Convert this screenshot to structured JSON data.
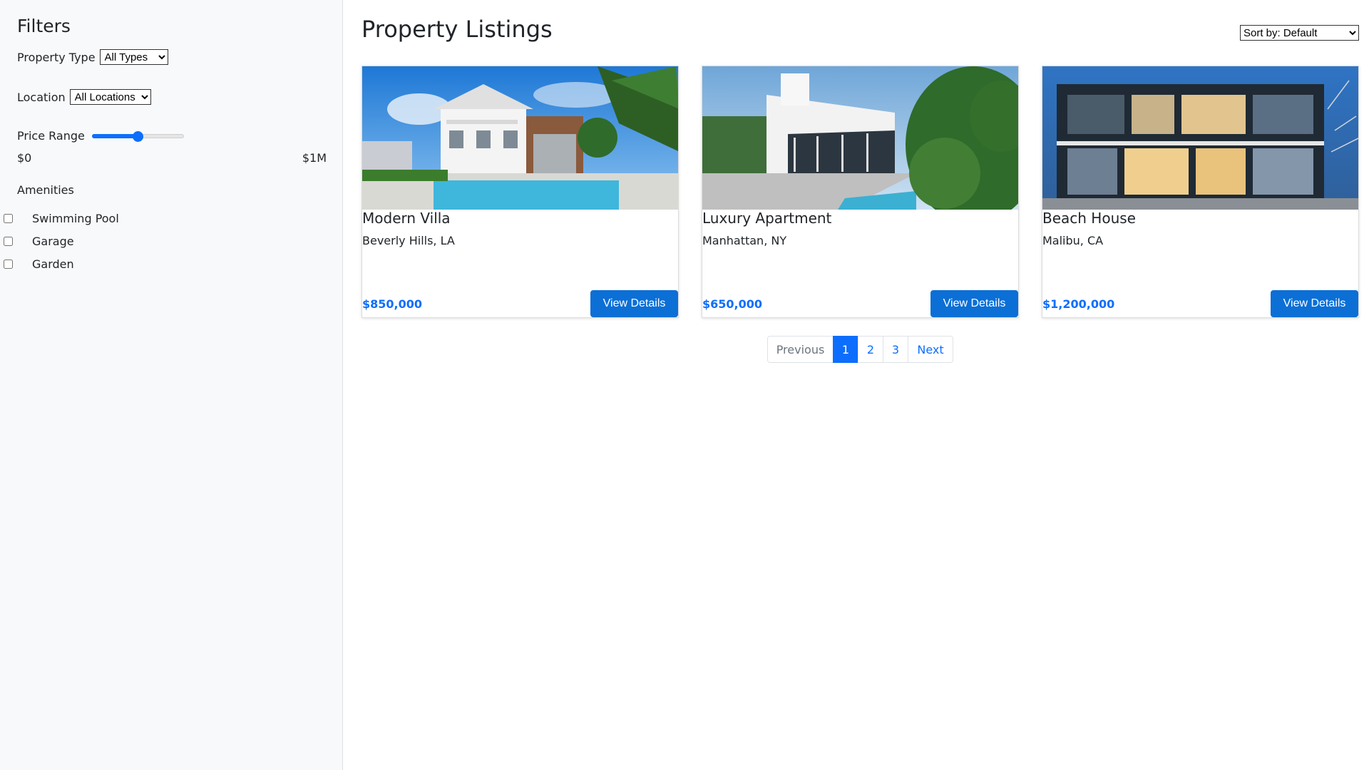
{
  "sidebar": {
    "title": "Filters",
    "property_type": {
      "label": "Property Type",
      "selected": "All Types"
    },
    "location": {
      "label": "Location",
      "selected": "All Locations"
    },
    "price_range": {
      "label": "Price Range",
      "min_label": "$0",
      "max_label": "$1M",
      "value_fraction": 0.5
    },
    "amenities": {
      "title": "Amenities",
      "items": [
        {
          "label": "Swimming Pool",
          "checked": false
        },
        {
          "label": "Garage",
          "checked": false
        },
        {
          "label": "Garden",
          "checked": false
        }
      ]
    }
  },
  "main": {
    "title": "Property Listings",
    "sort": {
      "selected": "Sort by: Default"
    },
    "listings": [
      {
        "title": "Modern Villa",
        "location": "Beverly Hills, LA",
        "price": "$850,000",
        "button": "View Details"
      },
      {
        "title": "Luxury Apartment",
        "location": "Manhattan, NY",
        "price": "$650,000",
        "button": "View Details"
      },
      {
        "title": "Beach House",
        "location": "Malibu, CA",
        "price": "$1,200,000",
        "button": "View Details"
      }
    ]
  },
  "pagination": {
    "previous": "Previous",
    "pages": [
      "1",
      "2",
      "3"
    ],
    "active_page": "1",
    "next": "Next"
  },
  "colors": {
    "accent": "#0d6efd",
    "sidebar_bg": "#f8f9fa",
    "price": "#0d6efd"
  }
}
